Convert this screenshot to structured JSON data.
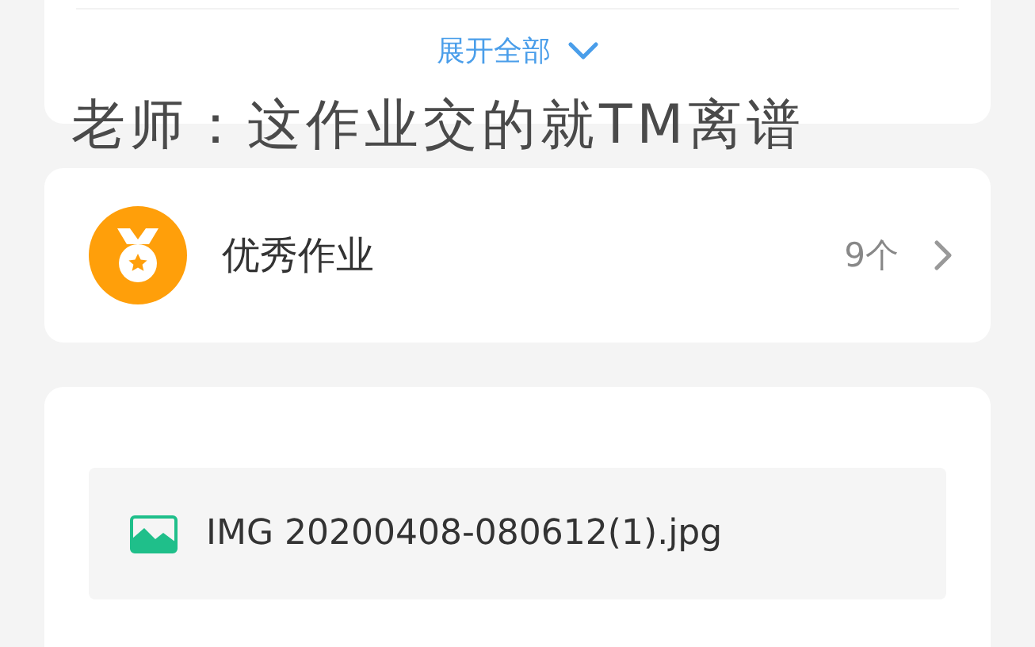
{
  "expand_link": {
    "label": "展开全部"
  },
  "caption": "老师：这作业交的就TM离谱",
  "excellent_homework": {
    "title": "优秀作业",
    "count": "9个"
  },
  "attachment": {
    "filename": "IMG 20200408-080612(1).jpg"
  }
}
